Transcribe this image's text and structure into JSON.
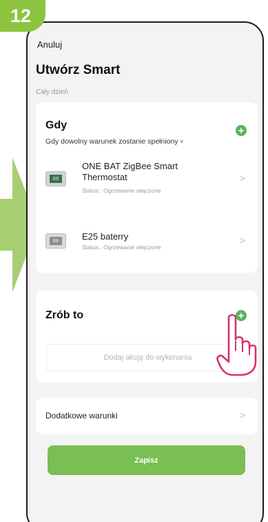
{
  "tutorial": {
    "step_number": "12"
  },
  "header": {
    "cancel_label": "Anuluj",
    "title": "Utwórz Smart",
    "subtitle": "Cały dzień"
  },
  "when_section": {
    "title": "Gdy",
    "condition_note": "Gdy dowolny warunek zostanie spełniony",
    "caret": "▾",
    "add_icon": "plus-circle-icon",
    "devices": [
      {
        "name": "ONE BAT ZigBee Smart Thermostat",
        "status": "Status : Ogrzewanie włączone",
        "thumb_text": "88"
      },
      {
        "name": "E25 baterry",
        "status": "Status : Ogrzewanie włączone",
        "thumb_text": "88"
      }
    ]
  },
  "do_section": {
    "title": "Zrób to",
    "add_icon": "plus-circle-icon",
    "action_placeholder": "Dodaj akcję do wykonania"
  },
  "extra_conditions": {
    "label": "Dodatkowe warunki"
  },
  "save_button": {
    "label": "Zapisz"
  },
  "colors": {
    "accent_green": "#79bf53",
    "add_button_green": "#5bb35b",
    "step_badge_green": "#8dc43f",
    "hand_outline": "#d6316c"
  }
}
